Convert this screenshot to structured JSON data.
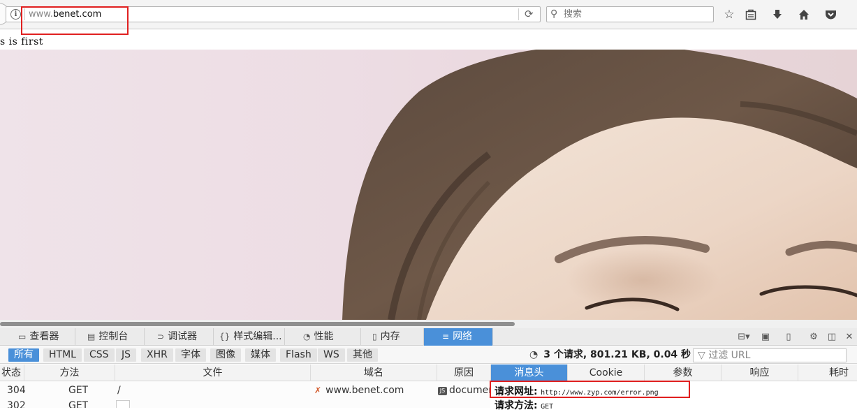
{
  "browser": {
    "url_prefix": "www.",
    "url_domain": "benet.com",
    "search_placeholder": "搜索",
    "icons": [
      "info-icon",
      "reload-icon",
      "search-icon",
      "bookmark-star-icon",
      "reading-list-icon",
      "download-icon",
      "home-icon",
      "pocket-icon"
    ]
  },
  "page": {
    "text": "s is first"
  },
  "devtools": {
    "tabs": [
      {
        "label": "查看器",
        "icon": "inspector-icon"
      },
      {
        "label": "控制台",
        "icon": "console-icon"
      },
      {
        "label": "调试器",
        "icon": "debugger-icon"
      },
      {
        "label": "样式编辑...",
        "icon": "style-editor-icon"
      },
      {
        "label": "性能",
        "icon": "performance-icon"
      },
      {
        "label": "内存",
        "icon": "memory-icon"
      },
      {
        "label": "网络",
        "icon": "network-icon",
        "active": true
      }
    ],
    "filters": [
      "所有",
      "HTML",
      "CSS",
      "JS",
      "XHR",
      "字体",
      "图像",
      "媒体",
      "Flash",
      "WS",
      "其他"
    ],
    "summary": "3 个请求, 801.21 KB, 0.04 秒",
    "filter_placeholder": "过滤 URL",
    "columns": [
      "状态",
      "方法",
      "文件",
      "域名",
      "原因",
      "消息头",
      "Cookie",
      "参数",
      "响应",
      "耗时"
    ],
    "requests": [
      {
        "status": "304",
        "method": "GET",
        "file": "/",
        "domain": "www.benet.com",
        "cause": "document"
      },
      {
        "status": "302",
        "method": "GET",
        "file": "",
        "domain": "",
        "cause": ""
      }
    ],
    "detail": {
      "url_key": "请求网址:",
      "url_value": "http://www.zyp.com/error.png",
      "method_key": "请求方法:",
      "method_value": "GET"
    }
  }
}
